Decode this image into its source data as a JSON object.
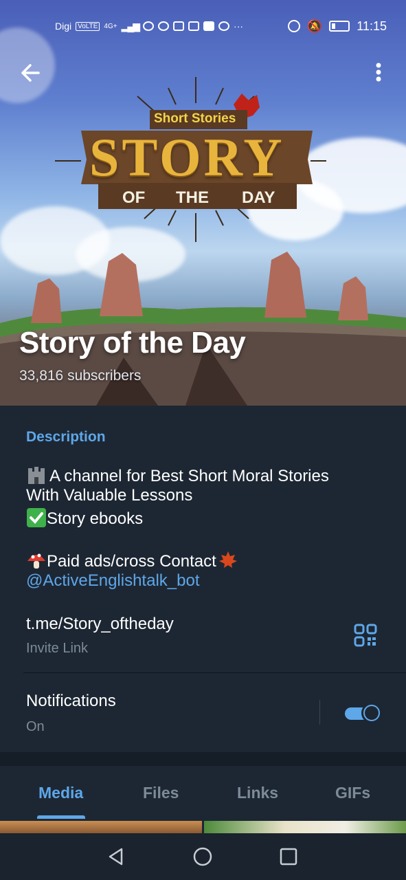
{
  "status_bar": {
    "carrier": "Digi",
    "volte": "VoLTE",
    "network": "4G+",
    "time": "11:15"
  },
  "header": {
    "back_icon": "arrow-left-icon",
    "menu_icon": "more-vertical-icon",
    "logo": {
      "top_text": "Short Stories",
      "main_text": "STORY",
      "bottom_words": [
        "OF",
        "THE",
        "DAY"
      ]
    },
    "title": "Story of the Day",
    "subscribers": "33,816 subscribers"
  },
  "description": {
    "label": "Description",
    "line1": "A channel for Best Short Moral Stories",
    "line2": "With Valuable Lessons",
    "line3": "Story ebooks",
    "line4": "Paid ads/cross Contact",
    "line5": "@ActiveEnglishtalk_bot"
  },
  "invite": {
    "value": "t.me/Story_oftheday",
    "caption": "Invite Link",
    "qr_icon": "qr-code-icon"
  },
  "notifications": {
    "title": "Notifications",
    "state": "On",
    "enabled": true
  },
  "tabs": [
    {
      "label": "Media",
      "active": true
    },
    {
      "label": "Files",
      "active": false
    },
    {
      "label": "Links",
      "active": false
    },
    {
      "label": "GIFs",
      "active": false
    }
  ],
  "colors": {
    "accent": "#5ea7e9",
    "background": "#1d2733",
    "secondary_text": "#7d8b99"
  },
  "navbar": {
    "back": "triangle-back-icon",
    "home": "circle-home-icon",
    "recents": "square-recents-icon"
  }
}
